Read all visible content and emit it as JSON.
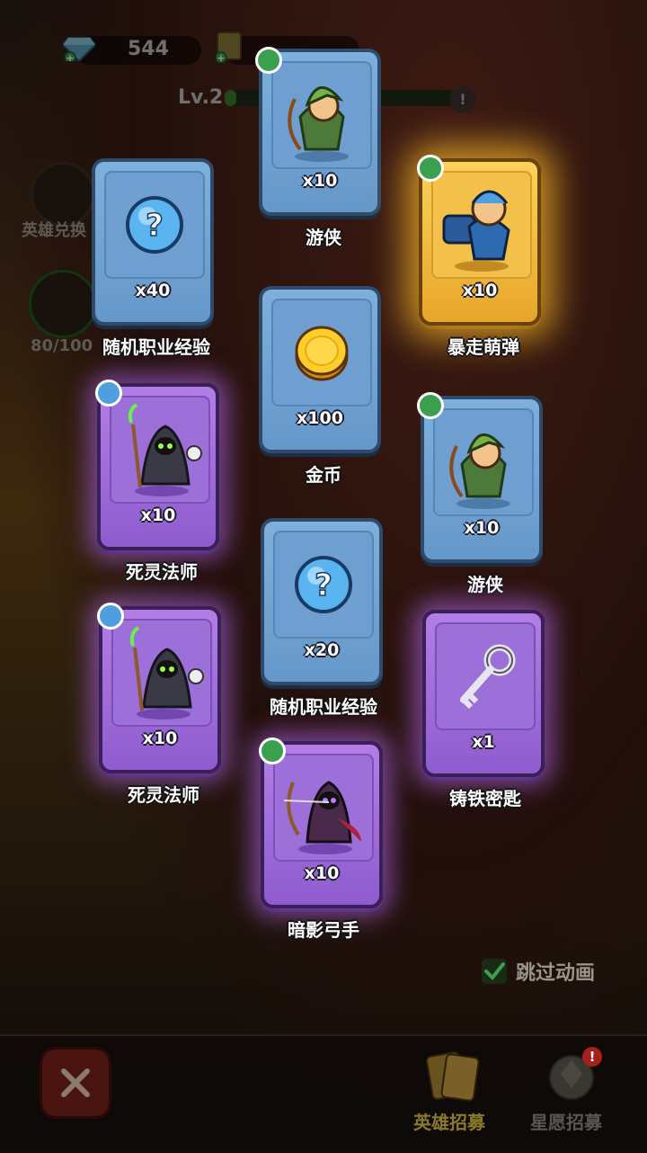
{
  "hud": {
    "gems": "544",
    "level": "Lv.2",
    "level_progress": 0.05,
    "side_left_label": "英雄兑换",
    "side_left_progress": "80/100"
  },
  "cards": [
    {
      "name": "游侠",
      "qty": "x10",
      "rarity": "blue",
      "art": "ranger-hero-icon",
      "badge": "green"
    },
    {
      "name": "随机职业经验",
      "qty": "x40",
      "rarity": "blue",
      "art": "random-exp-orb-icon",
      "badge": ""
    },
    {
      "name": "暴走萌弹",
      "qty": "x10",
      "rarity": "gold",
      "art": "cannon-hero-icon",
      "badge": "green"
    },
    {
      "name": "金币",
      "qty": "x100",
      "rarity": "blue",
      "art": "gold-coin-icon",
      "badge": ""
    },
    {
      "name": "死灵法师",
      "qty": "x10",
      "rarity": "purple",
      "art": "necromancer-hero-icon",
      "badge": "blue"
    },
    {
      "name": "游侠",
      "qty": "x10",
      "rarity": "blue",
      "art": "ranger-hero-icon",
      "badge": "green"
    },
    {
      "name": "随机职业经验",
      "qty": "x20",
      "rarity": "blue",
      "art": "random-exp-orb-icon",
      "badge": ""
    },
    {
      "name": "死灵法师",
      "qty": "x10",
      "rarity": "purple",
      "art": "necromancer-hero-icon",
      "badge": "blue"
    },
    {
      "name": "铸铁密匙",
      "qty": "x1",
      "rarity": "purple",
      "art": "iron-key-icon",
      "badge": ""
    },
    {
      "name": "暗影弓手",
      "qty": "x10",
      "rarity": "purple",
      "art": "shadow-archer-hero-icon",
      "badge": "green"
    }
  ],
  "skip_animation": {
    "label": "跳过动画",
    "checked": true
  },
  "bottom_tabs": {
    "hero_recruit": "英雄招募",
    "wish_recruit": "星愿招募"
  },
  "colors": {
    "blue_card": "#6f9fd0",
    "purple_card": "#9d6fd8",
    "gold_card": "#f3c04a"
  }
}
